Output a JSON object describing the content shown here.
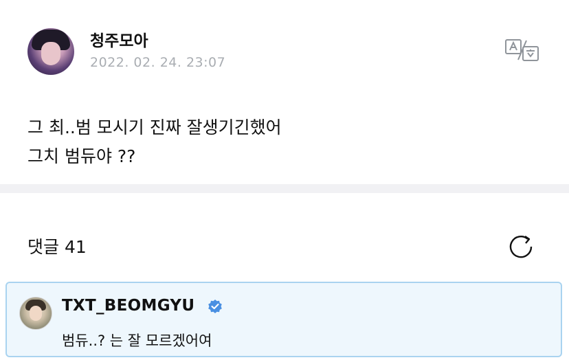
{
  "post": {
    "author": "청주모아",
    "date": "2022. 02. 24. 23:07",
    "lines": [
      "그 최..범 모시기 진짜 잘생기긴했어",
      "그치 범듀야 ??"
    ]
  },
  "comments": {
    "label": "댓글",
    "count": "41"
  },
  "reply": {
    "author": "TXT_BEOMGYU",
    "verified": true,
    "text": "범듀..? 는 잘 모르겠어여"
  },
  "icons": {
    "translate": "translate-icon",
    "refresh": "refresh-icon",
    "verified": "verified-badge-icon"
  },
  "colors": {
    "date_gray": "#a9adb2",
    "reply_bg": "#eef7fd",
    "reply_border": "#a9d3f0",
    "verified_blue": "#4a90e2"
  }
}
